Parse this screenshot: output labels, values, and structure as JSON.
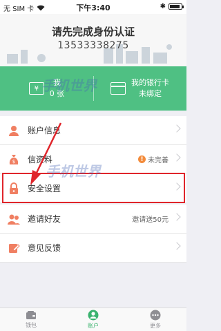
{
  "status_bar": {
    "carrier": "无 SIM 卡",
    "time": "下午3:40",
    "bluetooth": "✱"
  },
  "header": {
    "title": "请先完成身份认证",
    "phone": "13533338275"
  },
  "cards": {
    "left_line1": "我",
    "left_line2": "0 张",
    "right_line1": "我的银行卡",
    "right_line2": "未绑定"
  },
  "menu": {
    "account_info": "账户信息",
    "credit_info": "信",
    "credit_info_suffix": "资料",
    "credit_status": "未完善",
    "security": "安全设置",
    "invite": "邀请好友",
    "invite_note": "邀请送50元",
    "feedback": "意见反馈"
  },
  "tabbar": {
    "wallet": "钱包",
    "account": "账户",
    "more": "更多"
  },
  "watermark": "手机世界",
  "colors": {
    "accent_green": "#4fc083",
    "tab_active": "#3bb36f",
    "highlight_red": "#e0252b",
    "warning_orange": "#f38b3b"
  }
}
